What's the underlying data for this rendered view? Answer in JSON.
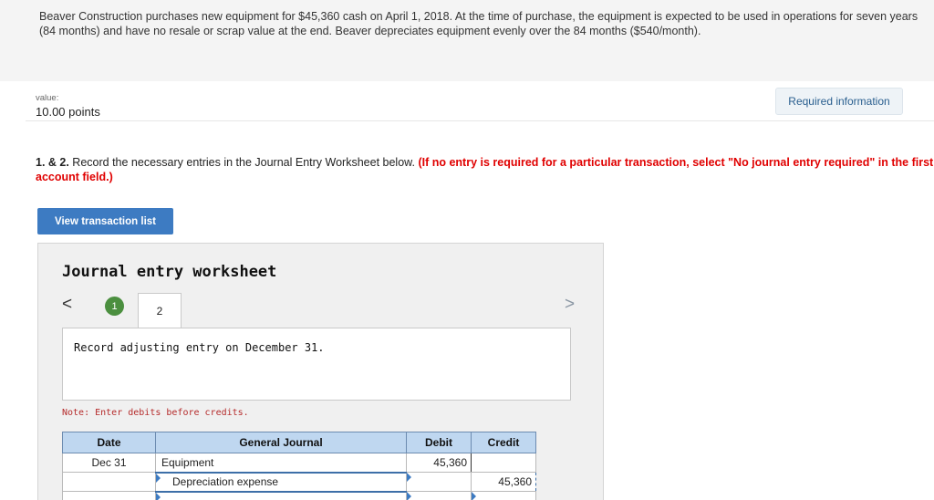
{
  "problem": {
    "text": "Beaver Construction purchases new equipment for $45,360 cash on April 1, 2018. At the time of purchase, the equipment is expected to be used in operations for seven years (84 months) and have no resale or scrap value at the end. Beaver depreciates equipment evenly over the 84 months ($540/month)."
  },
  "value": {
    "label": "value:",
    "points": "10.00 points"
  },
  "required_info_label": "Required information",
  "instructions": {
    "prefix": "1. & 2.",
    "text": " Record the necessary entries in the Journal Entry Worksheet below. ",
    "warning": "(If no entry is required for a particular transaction, select \"No journal entry required\" in the first account field.)"
  },
  "view_transactions_label": "View transaction list",
  "worksheet": {
    "title": "Journal entry worksheet",
    "prev_glyph": "<",
    "next_glyph": ">",
    "steps": [
      "1",
      "2"
    ],
    "entry_description": "Record adjusting entry on December 31.",
    "note": "Note: Enter debits before credits.",
    "table": {
      "headers": [
        "Date",
        "General Journal",
        "Debit",
        "Credit"
      ],
      "rows": [
        {
          "date": "Dec 31",
          "account": "Equipment",
          "debit": "45,360",
          "credit": ""
        },
        {
          "date": "",
          "account": "Depreciation expense",
          "debit": "",
          "credit": "45,360"
        },
        {
          "date": "",
          "account": "",
          "debit": "",
          "credit": ""
        }
      ]
    }
  },
  "colors": {
    "accent": "#3d7bc2",
    "warning_red": "#e00000",
    "step_complete": "#4b8f3f",
    "table_header": "#bfd7f0"
  }
}
